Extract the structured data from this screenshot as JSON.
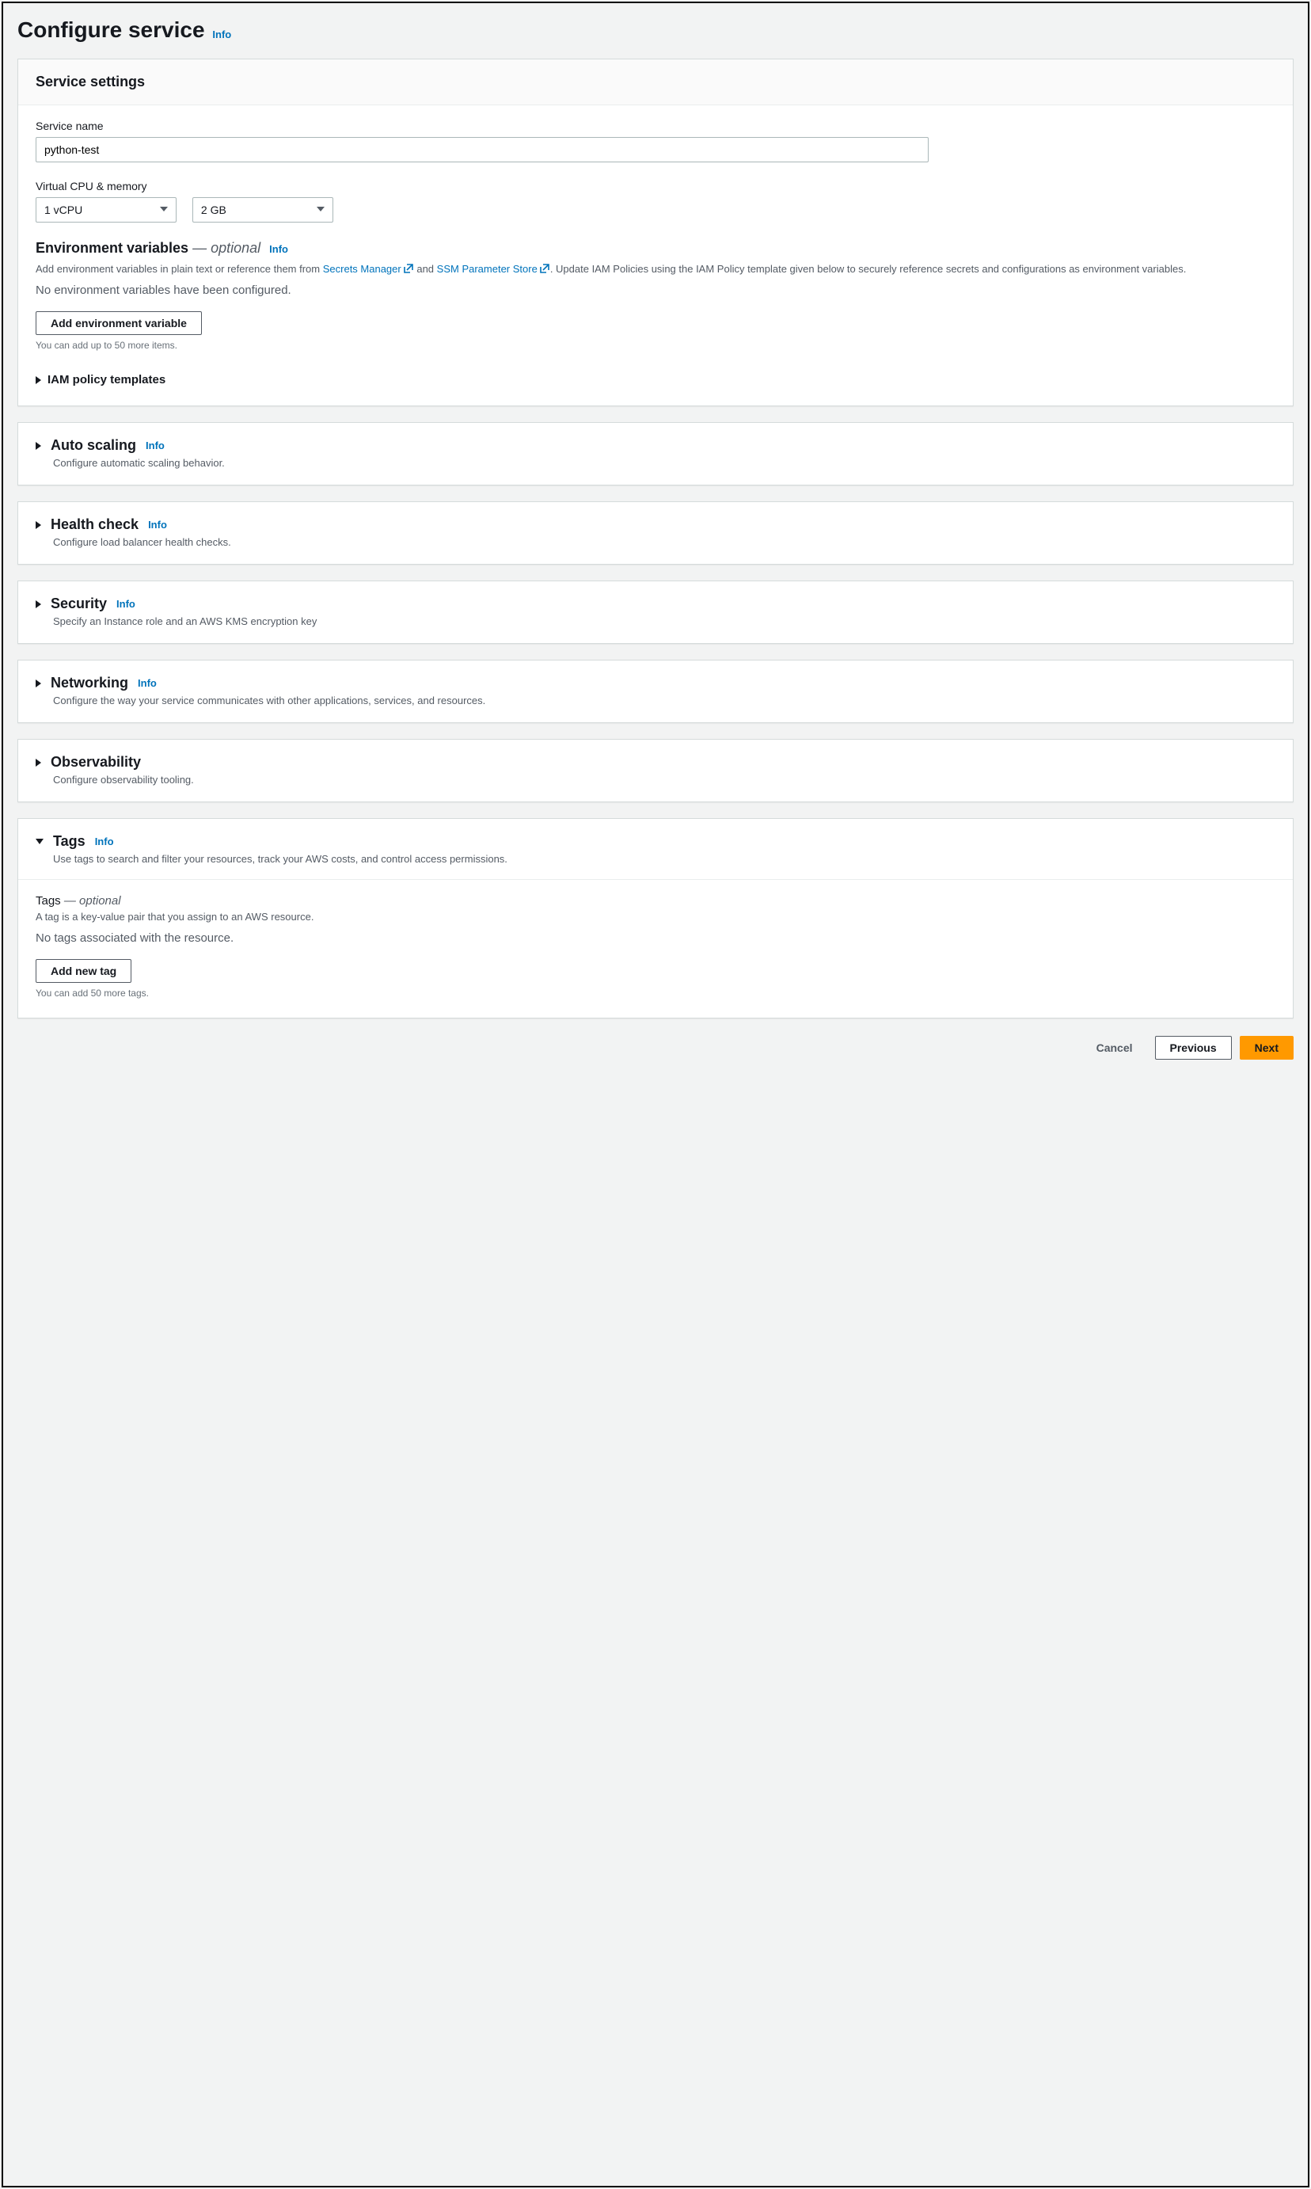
{
  "page": {
    "title": "Configure service",
    "info": "Info"
  },
  "serviceSettings": {
    "header": "Service settings",
    "serviceNameLabel": "Service name",
    "serviceNameValue": "python-test",
    "vcpuMemLabel": "Virtual CPU & memory",
    "vcpuValue": "1 vCPU",
    "memValue": "2 GB",
    "envVars": {
      "title": "Environment variables",
      "optional": "optional",
      "info": "Info",
      "helpPrefix": "Add environment variables in plain text or reference them from ",
      "secretsLink": "Secrets Manager",
      "helpMid": " and ",
      "ssmLink": "SSM Parameter Store",
      "helpSuffix": ". Update IAM Policies using the IAM Policy template given below to securely reference secrets and configurations as environment variables.",
      "emptyText": "No environment variables have been configured.",
      "addButton": "Add environment variable",
      "limitNote": "You can add up to 50 more items.",
      "iamExpander": "IAM policy templates"
    }
  },
  "sections": {
    "autoScaling": {
      "title": "Auto scaling",
      "info": "Info",
      "desc": "Configure automatic scaling behavior."
    },
    "healthCheck": {
      "title": "Health check",
      "info": "Info",
      "desc": "Configure load balancer health checks."
    },
    "security": {
      "title": "Security",
      "info": "Info",
      "desc": "Specify an Instance role and an AWS KMS encryption key"
    },
    "networking": {
      "title": "Networking",
      "info": "Info",
      "desc": "Configure the way your service communicates with other applications, services, and resources."
    },
    "observability": {
      "title": "Observability",
      "desc": "Configure observability tooling."
    },
    "tags": {
      "title": "Tags",
      "info": "Info",
      "desc": "Use tags to search and filter your resources, track your AWS costs, and control access permissions.",
      "subTitle": "Tags",
      "optional": "optional",
      "subHelp": "A tag is a key-value pair that you assign to an AWS resource.",
      "emptyText": "No tags associated with the resource.",
      "addButton": "Add new tag",
      "limitNote": "You can add 50 more tags."
    }
  },
  "footer": {
    "cancel": "Cancel",
    "previous": "Previous",
    "next": "Next"
  }
}
